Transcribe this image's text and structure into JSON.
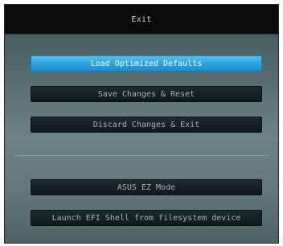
{
  "dialog": {
    "title": "Exit"
  },
  "buttons": [
    {
      "label": "Load Optimized Defaults",
      "selected": true
    },
    {
      "label": "Save Changes & Reset",
      "selected": false
    },
    {
      "label": "Discard Changes & Exit",
      "selected": false
    },
    {
      "label": "ASUS EZ Mode",
      "selected": false
    },
    {
      "label": "Launch EFI Shell from filesystem device",
      "selected": false
    }
  ],
  "colors": {
    "selected_button": "#2aa3e2",
    "normal_button": "#132024",
    "titlebar": "#0b0b0b",
    "dialog_background": "#5f7477"
  }
}
